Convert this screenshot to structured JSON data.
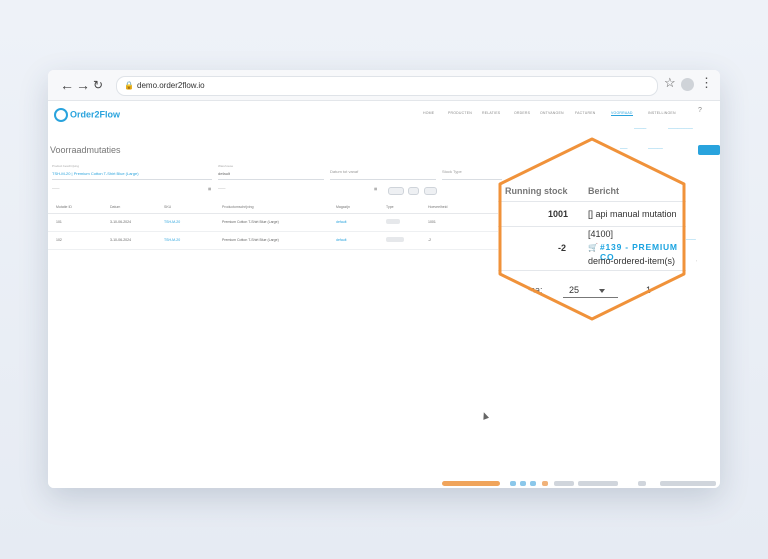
{
  "browser": {
    "url": "demo.order2flow.io"
  },
  "app": {
    "logo": "Order2Flow",
    "menu": [
      "HOME",
      "PRODUCTEN",
      "RELATIES",
      "ORDERS",
      "ONTVANGEN",
      "FACTUREN",
      "VOORRAAD",
      "INSTELLINGEN"
    ],
    "active_menu": "VOORRAAD",
    "page_title": "Voorraadmutaties",
    "filters": {
      "product_label": "Product beschrijving",
      "product_value": "TSH-M-20 | Premium Cotton T-Shirt Blue (Large)",
      "warehouse_label": "Warehouse",
      "warehouse_value": "default",
      "date_label": "Datum tot vanaf",
      "stock_type_label": "Stock Type"
    },
    "table_headers": [
      "Mutatie ID",
      "Datum",
      "SKU",
      "Productomschrijving",
      "Magazijn",
      "Type",
      "Hoeveelheid"
    ],
    "rows": [
      {
        "id": "101",
        "date": "3-10-06-2024",
        "sku": "TSH-M-20",
        "desc": "Premium Cotton T-Shirt Blue (Large)",
        "wh": "default",
        "qty": "1001"
      },
      {
        "id": "102",
        "date": "3-10-06-2024",
        "sku": "TSH-M-20",
        "desc": "Premium Cotton T-Shirt Blue (Large)",
        "wh": "default",
        "qty": "-2"
      }
    ]
  },
  "magnifier": {
    "headers": {
      "running_stock": "Running stock",
      "bericht": "Bericht"
    },
    "row1": {
      "running_stock": "1001",
      "bericht": "[] api manual mutation"
    },
    "row2": {
      "running_stock": "-2",
      "code": "[4100]",
      "link": "#139 - PREMIUM CO",
      "item": "demo-ordered-item(s)"
    },
    "pagination": {
      "label": "ina:",
      "per_page": "25",
      "page": "1"
    }
  },
  "colors": {
    "accent": "#29a3dd",
    "highlight_border": "#f0923a"
  }
}
